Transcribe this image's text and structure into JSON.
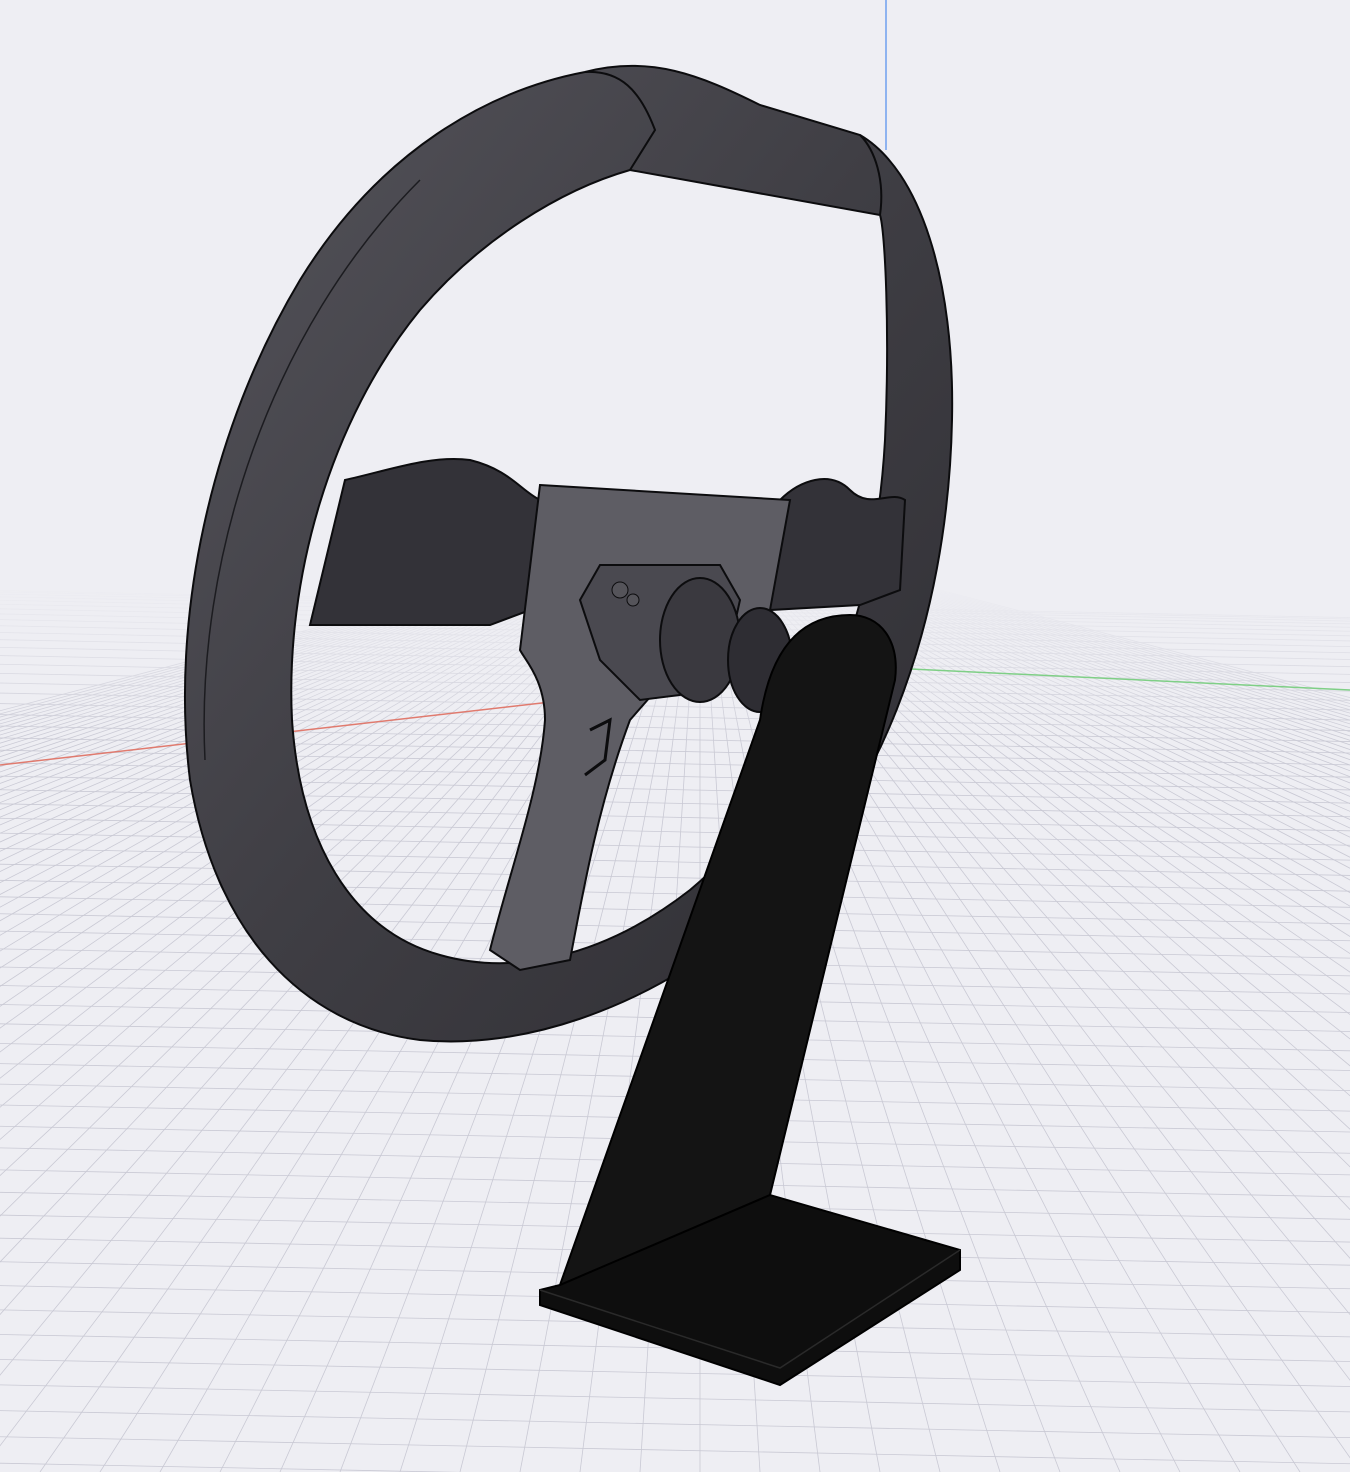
{
  "viewport": {
    "background": "#eeeef3",
    "grid_color": "#c9c9d4",
    "axes": {
      "x_color": "#e07a6e",
      "y_color": "#7fcf86",
      "z_color": "#6f9ff0"
    }
  },
  "model": {
    "rim_color": "#3d3c42",
    "rim_highlight": "#57565d",
    "spoke_color": "#5e5d64",
    "hub_color": "#4a4950",
    "stand_color": "#141414",
    "edge_color": "#0c0c0e"
  }
}
